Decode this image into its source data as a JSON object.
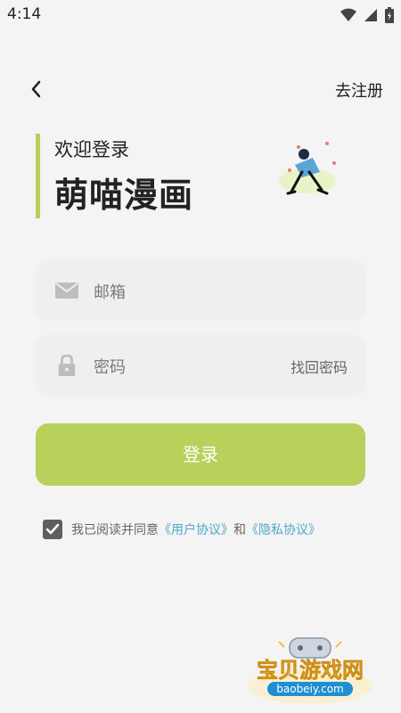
{
  "status_bar": {
    "time": "4:14",
    "icons": [
      "wifi-icon",
      "signal-icon",
      "battery-icon"
    ]
  },
  "header": {
    "back_icon": "chevron-left-icon",
    "register_label": "去注册"
  },
  "title": {
    "welcome": "欢迎登录",
    "app_name": "萌喵漫画"
  },
  "form": {
    "email_placeholder": "邮箱",
    "password_placeholder": "密码",
    "find_password_label": "找回密码",
    "login_label": "登录"
  },
  "agreement": {
    "checked": true,
    "prefix": "我已阅读并同意",
    "user_agreement": "《用户协议》",
    "and": "和",
    "privacy_agreement": "《隐私协议》"
  },
  "watermark": {
    "brand": "宝贝游戏网",
    "domain": "baobeiy.com"
  },
  "colors": {
    "accent": "#b8d15a",
    "link": "#4fa7c8",
    "text": "#222222"
  }
}
